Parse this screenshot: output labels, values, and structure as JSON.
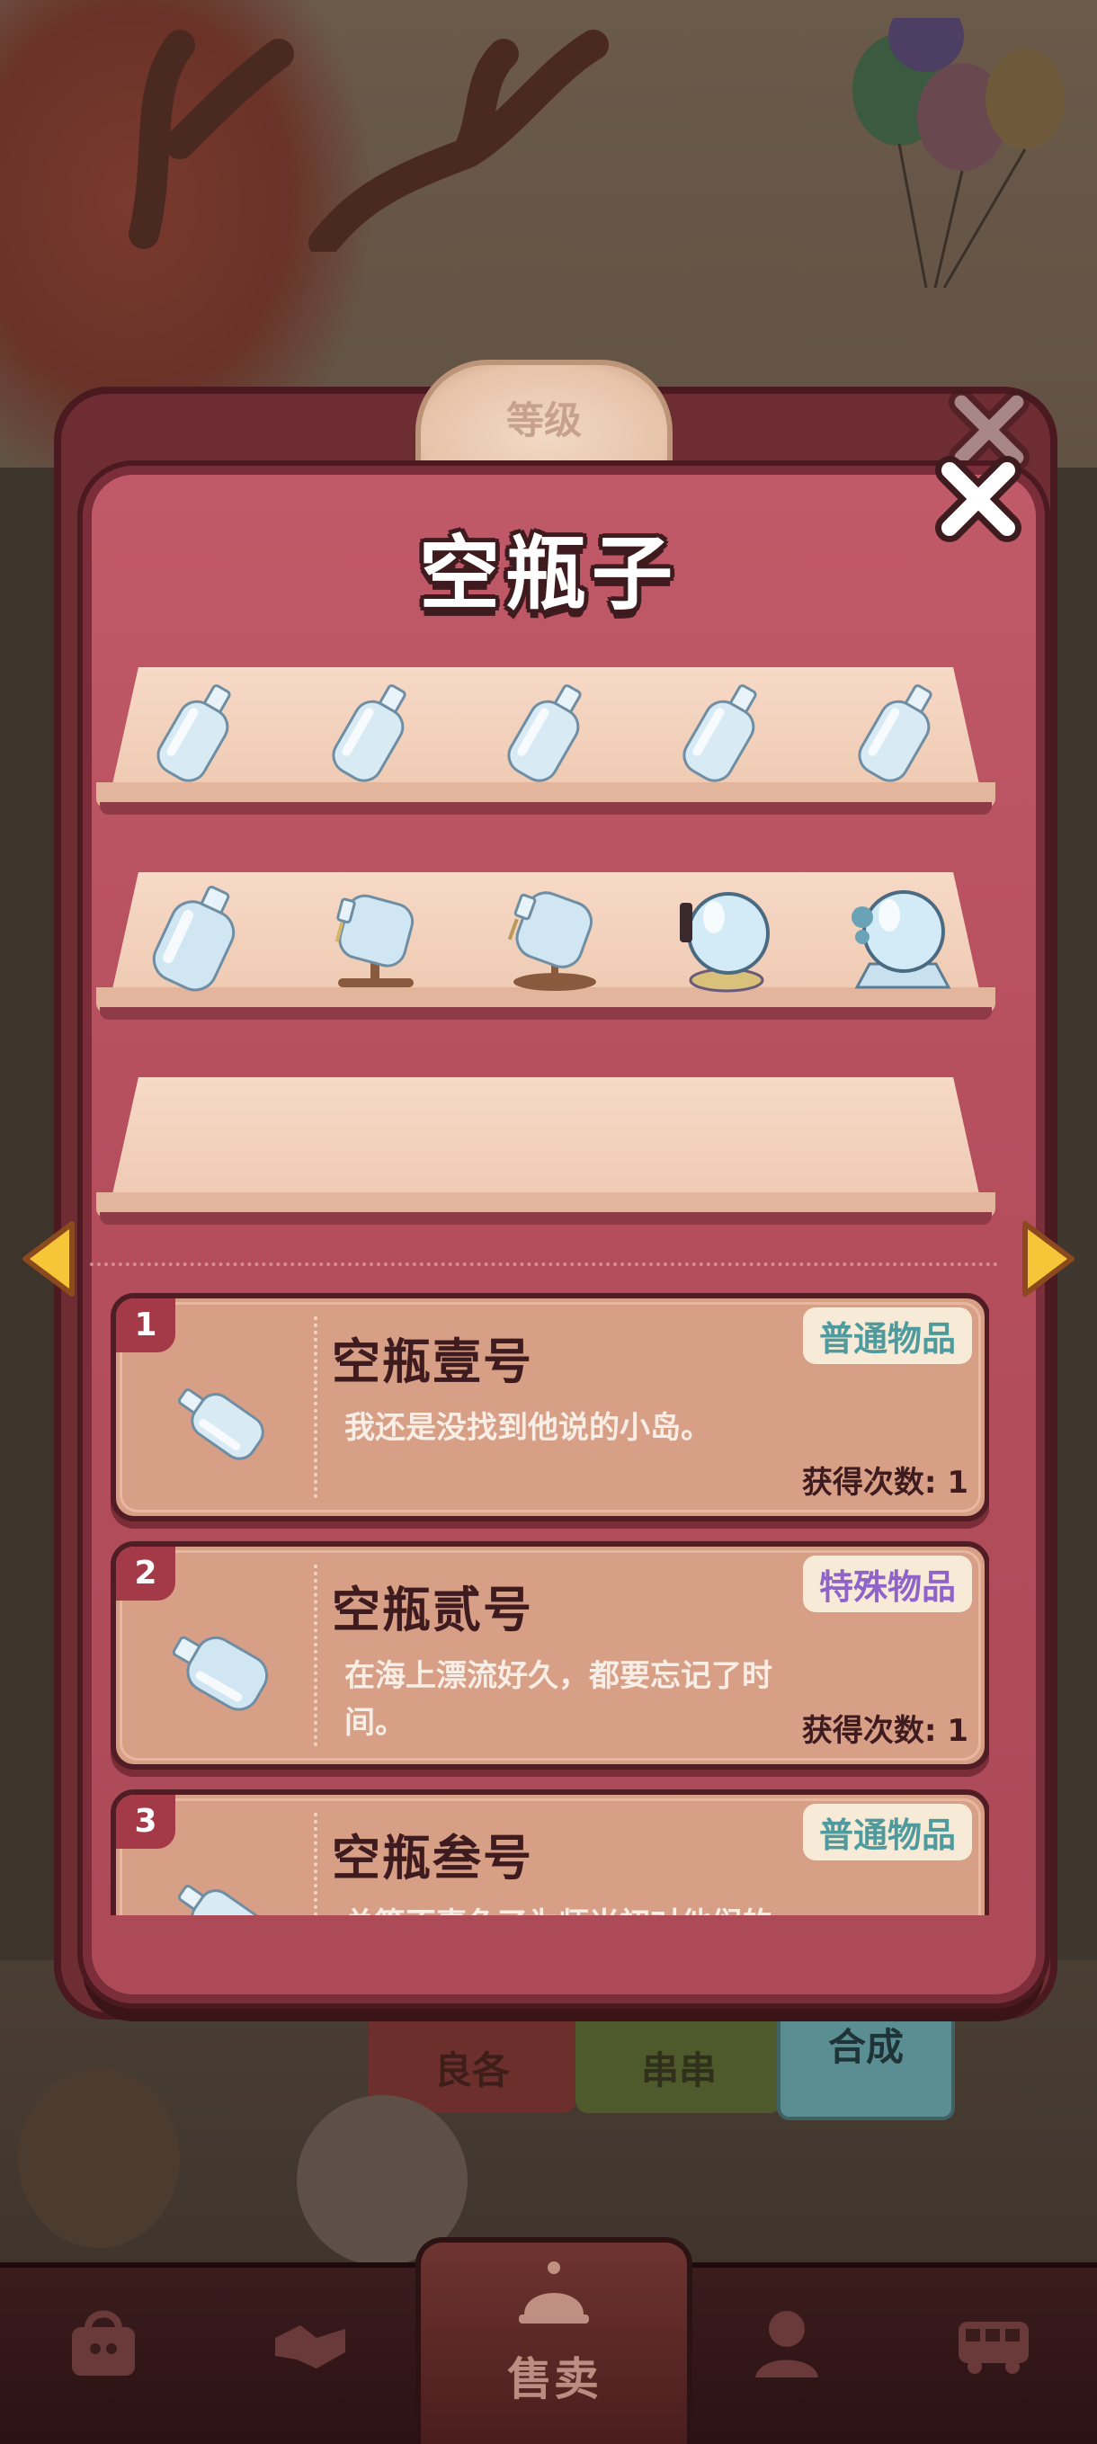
{
  "background": {
    "level_badge_label": "等级",
    "tab_labels": [
      "良各",
      "串串",
      "合成"
    ]
  },
  "dialog": {
    "title": "空瓶子",
    "close_icon": "close-x-icon",
    "prev_icon": "arrow-left-icon",
    "next_icon": "arrow-right-icon",
    "shelves": [
      {
        "items": [
          "bottle-icon",
          "bottle-icon",
          "bottle-icon",
          "bottle-icon",
          "bottle-icon"
        ]
      },
      {
        "items": [
          "bottle-large-icon",
          "bottle-on-stand-icon",
          "bottle-on-stand-icon",
          "crystal-ball-icon",
          "crystal-ball-icon"
        ]
      },
      {
        "items": []
      }
    ],
    "items": [
      {
        "num": "1",
        "name": "空瓶壹号",
        "tag": "普通物品",
        "tag_type": "normal",
        "desc": "我还是没找到他说的小岛。",
        "count": "获得次数: 1"
      },
      {
        "num": "2",
        "name": "空瓶贰号",
        "tag": "特殊物品",
        "tag_type": "special",
        "desc": "在海上漂流好久，都要忘记了时间。",
        "count": "获得次数: 1"
      },
      {
        "num": "3",
        "name": "空瓶叁号",
        "tag": "普通物品",
        "tag_type": "normal",
        "desc": "总算不辜负了为师当初对他们的",
        "count": ""
      }
    ]
  },
  "navbar": {
    "items": [
      {
        "icon": "bag-icon"
      },
      {
        "icon": "handshake-icon"
      },
      {
        "icon": "bell-icon",
        "label": "售卖"
      },
      {
        "icon": "person-icon"
      },
      {
        "icon": "bus-icon"
      }
    ]
  },
  "colors": {
    "dialog_bg": "#b64f5e",
    "card_bg": "#d89f87",
    "tag_normal": "#4e9a9d",
    "tag_special": "#8f63c8"
  }
}
